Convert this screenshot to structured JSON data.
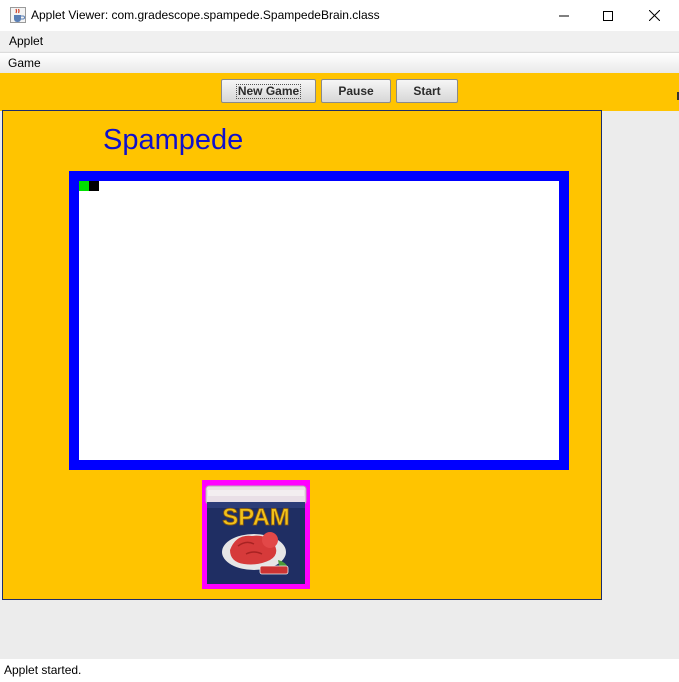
{
  "window": {
    "title": "Applet Viewer: com.gradescope.spampede.SpampedeBrain.class",
    "icon": "java-cup-icon",
    "controls": [
      "minimize-icon",
      "maximize-icon",
      "close-icon"
    ]
  },
  "menubar": {
    "applet_label": "Applet"
  },
  "game_menu": {
    "label": "Game"
  },
  "toolbar": {
    "background": "#ffc400",
    "new_game_label": "New Game",
    "pause_label": "Pause",
    "start_label": "Start"
  },
  "applet": {
    "title": "Spampede",
    "title_color": "#1010cc",
    "board_border_color": "#0000ff",
    "snake": {
      "head_color": "#00e000",
      "body_color": "#000000",
      "length": 2
    },
    "image": {
      "name": "spam-can-image",
      "caption": "SPAM",
      "background": "#ff00ff"
    }
  },
  "status": {
    "text": "Applet started."
  }
}
